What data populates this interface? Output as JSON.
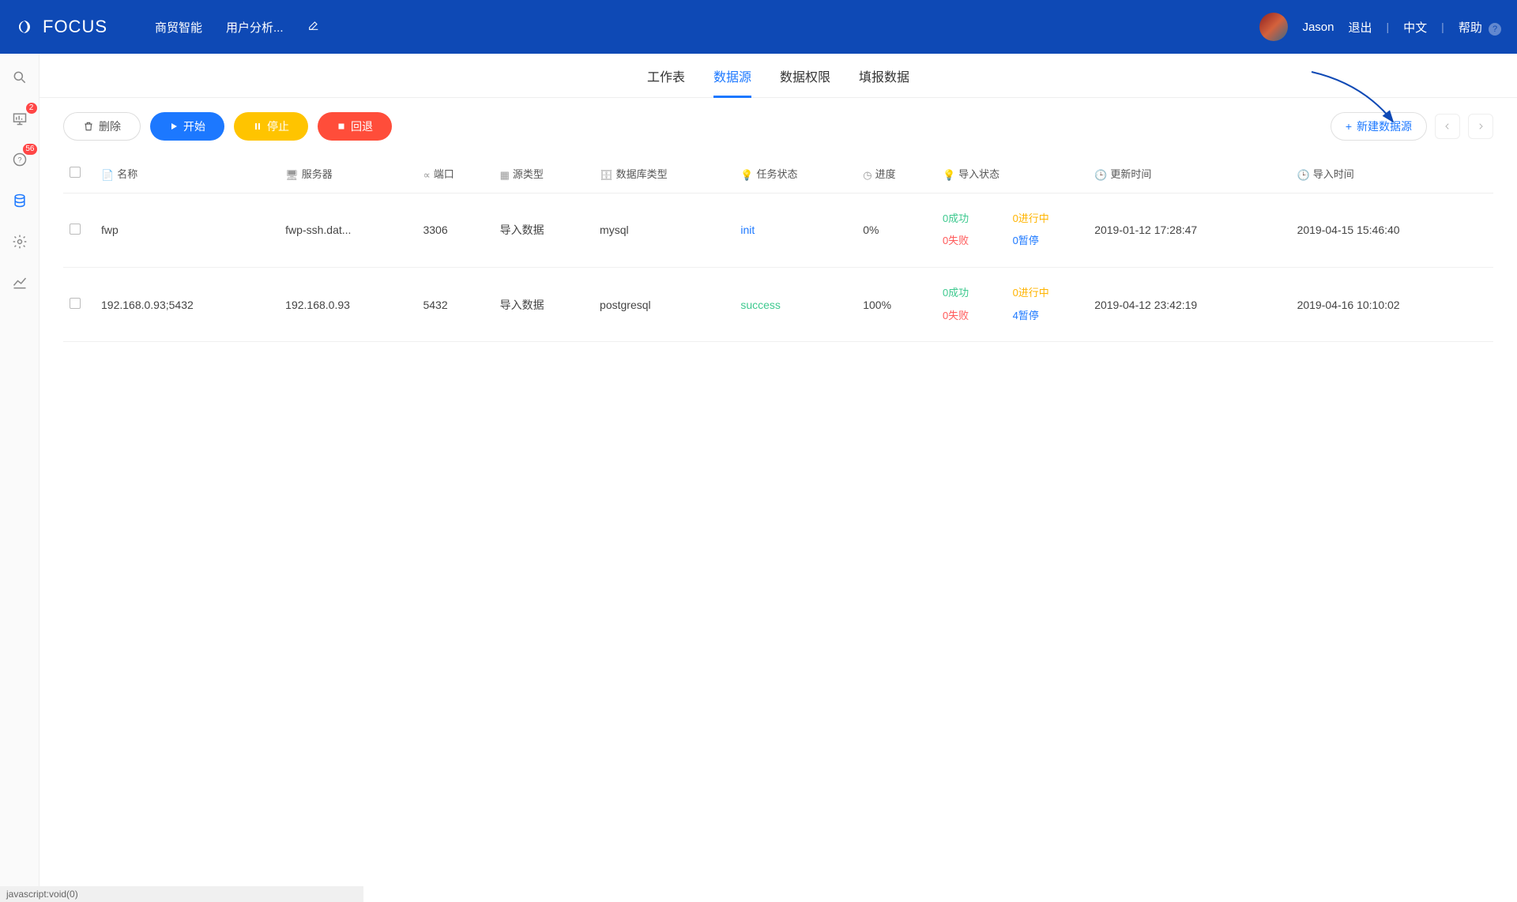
{
  "header": {
    "app_name": "FOCUS",
    "nav1": "商贸智能",
    "nav2": "用户分析...",
    "user_name": "Jason",
    "logout": "退出",
    "language": "中文",
    "help": "帮助"
  },
  "sidebar": {
    "badge1": "2",
    "badge2": "56"
  },
  "tabs": {
    "t1": "工作表",
    "t2": "数据源",
    "t3": "数据权限",
    "t4": "填报数据"
  },
  "toolbar": {
    "delete": "删除",
    "start": "开始",
    "stop": "停止",
    "rollback": "回退",
    "new_source": "新建数据源"
  },
  "columns": {
    "name": "名称",
    "server": "服务器",
    "port": "端口",
    "source_type": "源类型",
    "db_type": "数据库类型",
    "task_status": "任务状态",
    "progress": "进度",
    "import_status": "导入状态",
    "update_time": "更新时间",
    "import_time": "导入时间"
  },
  "import_labels": {
    "success": "成功",
    "fail": "失败",
    "in_progress": "进行中",
    "pause": "暂停"
  },
  "rows": [
    {
      "name": "fwp",
      "server": "fwp-ssh.dat...",
      "port": "3306",
      "source_type": "导入数据",
      "db_type": "mysql",
      "task_status": "init",
      "task_status_class": "status-blue",
      "progress": "0%",
      "status_success": "0",
      "status_fail": "0",
      "status_progress": "0",
      "status_pause": "0",
      "update_time": "2019-01-12 17:28:47",
      "import_time": "2019-04-15 15:46:40"
    },
    {
      "name": "192.168.0.93;5432",
      "server": "192.168.0.93",
      "port": "5432",
      "source_type": "导入数据",
      "db_type": "postgresql",
      "task_status": "success",
      "task_status_class": "status-green",
      "progress": "100%",
      "status_success": "0",
      "status_fail": "0",
      "status_progress": "0",
      "status_pause": "4",
      "update_time": "2019-04-12 23:42:19",
      "import_time": "2019-04-16 10:10:02"
    }
  ],
  "statusbar": "javascript:void(0)"
}
